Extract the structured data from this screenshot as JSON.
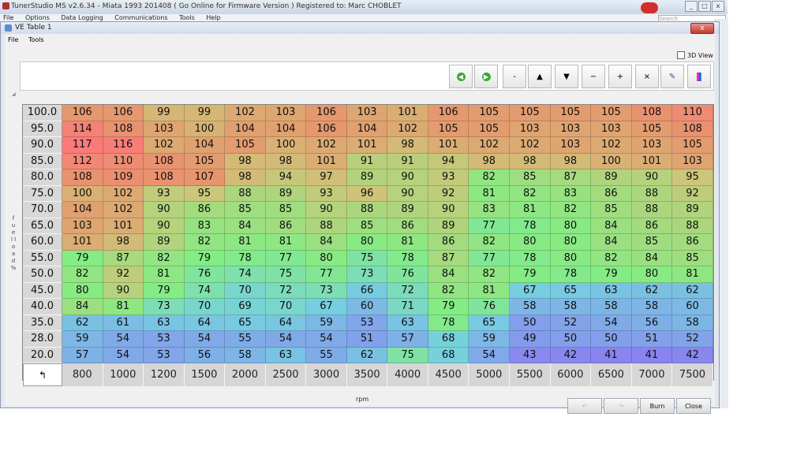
{
  "app": {
    "title": "TunerStudio MS v2.6.34 - Miata 1993 201408 ( Go Online for Firmware Version ) Registered to: Marc CHOBLET",
    "menu": [
      "File",
      "Options",
      "Data Logging",
      "Communications",
      "Tools",
      "Help"
    ],
    "search_placeholder": "Search"
  },
  "dialog": {
    "title": "VE Table 1",
    "menu": [
      "File",
      "Tools"
    ],
    "close_glyph": "x",
    "view3d_label": "3D View",
    "x_axis_label": "rpm",
    "y_axis_label": "f u e l l o a d %",
    "buttons": {
      "undo": "",
      "redo": "",
      "burn": "Burn",
      "close": "Close"
    }
  },
  "toolbar": [
    {
      "name": "previous-icon",
      "glyph": "◀"
    },
    {
      "name": "next-icon",
      "glyph": "▶"
    },
    {
      "name": "decrement-icon",
      "glyph": "-"
    },
    {
      "name": "increase-icon",
      "glyph": "▲"
    },
    {
      "name": "decrease-icon",
      "glyph": "▼"
    },
    {
      "name": "subtract-icon",
      "glyph": "−"
    },
    {
      "name": "add-icon",
      "glyph": "+"
    },
    {
      "name": "multiply-icon",
      "glyph": "×"
    },
    {
      "name": "pencil-icon",
      "glyph": "✎"
    },
    {
      "name": "color-icon",
      "glyph": "▮"
    }
  ],
  "chart_data": {
    "type": "heatmap",
    "xlabel": "rpm",
    "ylabel": "fuel load %",
    "x": [
      800,
      1000,
      1200,
      1500,
      2000,
      2500,
      3000,
      3500,
      4000,
      4500,
      5000,
      5500,
      6000,
      6500,
      7000,
      7500
    ],
    "y": [
      "100.0",
      "95.0",
      "90.0",
      "85.0",
      "80.0",
      "75.0",
      "70.0",
      "65.0",
      "60.0",
      "55.0",
      "50.0",
      "45.0",
      "40.0",
      "35.0",
      "28.0",
      "20.0"
    ],
    "values": [
      [
        106,
        106,
        99,
        99,
        102,
        103,
        106,
        103,
        101,
        106,
        105,
        105,
        105,
        105,
        108,
        110
      ],
      [
        114,
        108,
        103,
        100,
        104,
        104,
        106,
        104,
        102,
        105,
        105,
        103,
        103,
        103,
        105,
        108
      ],
      [
        117,
        116,
        102,
        104,
        105,
        100,
        102,
        101,
        98,
        101,
        102,
        102,
        103,
        102,
        103,
        105
      ],
      [
        112,
        110,
        108,
        105,
        98,
        98,
        101,
        91,
        91,
        94,
        98,
        98,
        98,
        100,
        101,
        103
      ],
      [
        108,
        109,
        108,
        107,
        98,
        94,
        97,
        89,
        90,
        93,
        82,
        85,
        87,
        89,
        90,
        95
      ],
      [
        100,
        102,
        93,
        95,
        88,
        89,
        93,
        96,
        90,
        92,
        81,
        82,
        83,
        86,
        88,
        92
      ],
      [
        104,
        102,
        90,
        86,
        85,
        85,
        90,
        88,
        89,
        90,
        83,
        81,
        82,
        85,
        88,
        89
      ],
      [
        103,
        101,
        90,
        83,
        84,
        86,
        88,
        85,
        86,
        89,
        77,
        78,
        80,
        84,
        86,
        88
      ],
      [
        101,
        98,
        89,
        82,
        81,
        81,
        84,
        80,
        81,
        86,
        82,
        80,
        80,
        84,
        85,
        86
      ],
      [
        79,
        87,
        82,
        79,
        78,
        77,
        80,
        75,
        78,
        87,
        77,
        78,
        80,
        82,
        84,
        85
      ],
      [
        82,
        92,
        81,
        76,
        74,
        75,
        77,
        73,
        76,
        84,
        82,
        79,
        78,
        79,
        80,
        81
      ],
      [
        80,
        90,
        79,
        74,
        70,
        72,
        73,
        66,
        72,
        82,
        81,
        67,
        65,
        63,
        62,
        62
      ],
      [
        84,
        81,
        73,
        70,
        69,
        70,
        67,
        60,
        71,
        79,
        76,
        58,
        58,
        58,
        58,
        60
      ],
      [
        62,
        61,
        63,
        64,
        65,
        64,
        59,
        53,
        63,
        78,
        65,
        50,
        52,
        54,
        56,
        58
      ],
      [
        59,
        54,
        53,
        54,
        55,
        54,
        54,
        51,
        57,
        68,
        59,
        49,
        50,
        50,
        51,
        52
      ],
      [
        57,
        54,
        53,
        56,
        58,
        63,
        55,
        62,
        75,
        68,
        54,
        43,
        42,
        41,
        41,
        42
      ]
    ]
  }
}
